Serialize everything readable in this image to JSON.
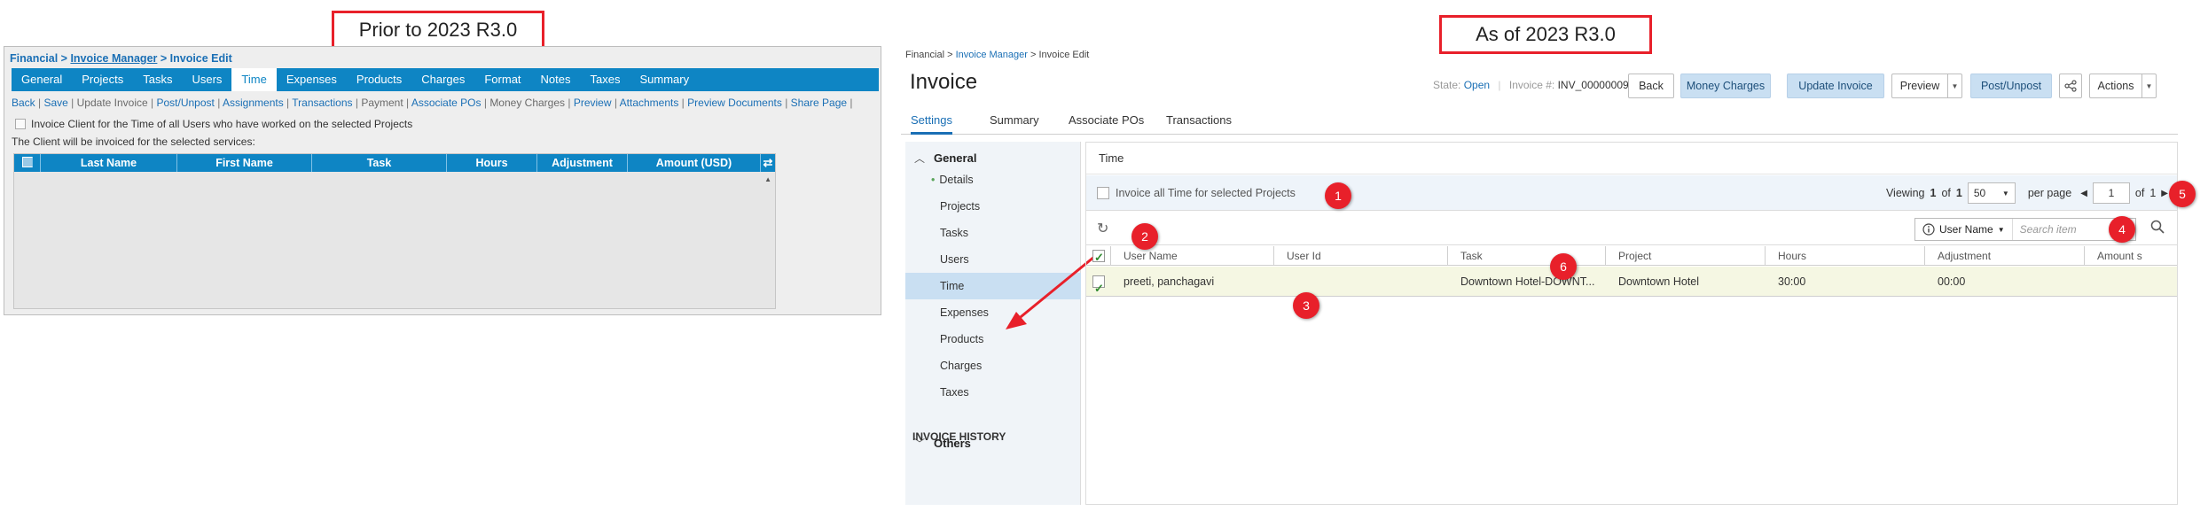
{
  "callouts": {
    "left": "Prior to 2023 R3.0",
    "right": "As of 2023 R3.0"
  },
  "old": {
    "breadcrumb": {
      "root": "Financial",
      "sep1": " > ",
      "mid": "Invoice Manager",
      "sep2": " > ",
      "current": "Invoice Edit"
    },
    "tabs": [
      "General",
      "Projects",
      "Tasks",
      "Users",
      "Time",
      "Expenses",
      "Products",
      "Charges",
      "Format",
      "Notes",
      "Taxes",
      "Summary"
    ],
    "active_tab": "Time",
    "links": [
      {
        "label": "Back",
        "enabled": true
      },
      {
        "label": "Save",
        "enabled": true
      },
      {
        "label": "Update Invoice",
        "enabled": false
      },
      {
        "label": "Post/Unpost",
        "enabled": true
      },
      {
        "label": "Assignments",
        "enabled": true
      },
      {
        "label": "Transactions",
        "enabled": true
      },
      {
        "label": "Payment",
        "enabled": false
      },
      {
        "label": "Associate POs",
        "enabled": true
      },
      {
        "label": "Money Charges",
        "enabled": false
      },
      {
        "label": "Preview",
        "enabled": true
      },
      {
        "label": "Attachments",
        "enabled": true
      },
      {
        "label": "Preview Documents",
        "enabled": true
      },
      {
        "label": "Share Page",
        "enabled": true
      }
    ],
    "invoice_all_label": "Invoice Client for the Time of all Users who have worked on the selected Projects",
    "note": "The Client will be invoiced for the selected services:",
    "grid_columns": [
      "Last Name",
      "First Name",
      "Task",
      "Hours",
      "Adjustment",
      "Amount (USD)"
    ]
  },
  "new": {
    "breadcrumb": {
      "root": "Financial",
      "sep1": " > ",
      "mid": "Invoice Manager",
      "sep2": " > ",
      "current": "Invoice Edit"
    },
    "title": "Invoice",
    "state_label": "State:",
    "state_value": "Open",
    "invoice_no_label": "Invoice #:",
    "invoice_no": "INV_00000009",
    "buttons": {
      "back": "Back",
      "money_charges": "Money Charges",
      "update_invoice": "Update Invoice",
      "preview": "Preview",
      "post_unpost": "Post/Unpost",
      "actions": "Actions"
    },
    "tabs": [
      "Settings",
      "Summary",
      "Associate POs",
      "Transactions"
    ],
    "active_tab": "Settings",
    "sidebar": {
      "general": "General",
      "items": [
        "Details",
        "Projects",
        "Tasks",
        "Users",
        "Time",
        "Expenses",
        "Products",
        "Charges",
        "Taxes"
      ],
      "active": "Time",
      "others": "Others",
      "history": "INVOICE HISTORY"
    },
    "section_title": "Time",
    "invoice_all_label": "Invoice all Time for selected Projects",
    "pager": {
      "viewing": "Viewing",
      "from": "1",
      "of_word": "of",
      "total": "1",
      "per_page_value": "50",
      "per_page_label": "per page",
      "page": "1",
      "of_pages_word": "of",
      "pages": "1"
    },
    "search": {
      "field": "User Name",
      "placeholder": "Search item"
    },
    "columns": [
      "User Name",
      "User Id",
      "Task",
      "Project",
      "Hours",
      "Adjustment",
      "Amount s"
    ],
    "rows": [
      {
        "user_name": "preeti, panchagavi",
        "user_id": "",
        "task": "Downtown Hotel-DOWNT...",
        "project": "Downtown Hotel",
        "hours": "30:00",
        "adjustment": "00:00",
        "amount": ""
      }
    ],
    "markers": [
      "1",
      "2",
      "3",
      "4",
      "5",
      "6"
    ]
  },
  "colors": {
    "accent": "#0e85c4",
    "link": "#1a6fb5",
    "callout_red": "#e8202a",
    "active_side": "#c9dff2"
  }
}
